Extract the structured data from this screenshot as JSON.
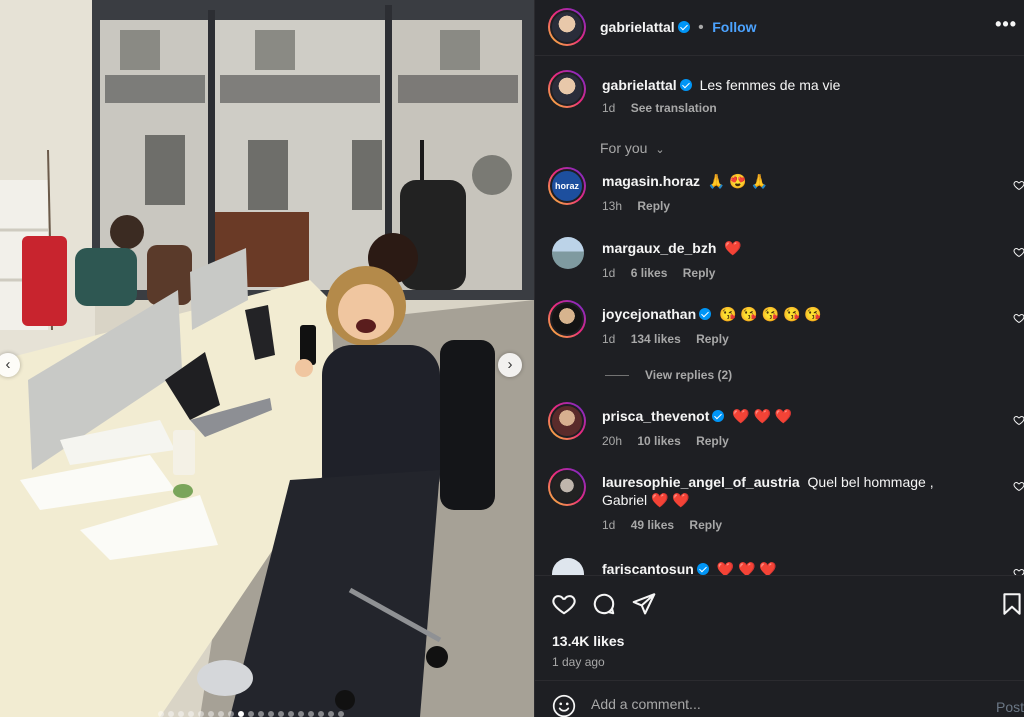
{
  "post": {
    "username": "gabrielattal",
    "follow_label": "Follow",
    "more_label": "•••",
    "caption": "Les femmes de ma vie",
    "caption_time": "1d",
    "see_translation": "See translation",
    "sort_label": "For you"
  },
  "comments": [
    {
      "user": "magasin.horaz",
      "text": "🙏 😍 🙏",
      "time": "13h",
      "likes": "",
      "reply": "Reply",
      "avatar_text": "horaz"
    },
    {
      "user": "margaux_de_bzh",
      "text": "❤️",
      "time": "1d",
      "likes": "6 likes",
      "reply": "Reply"
    },
    {
      "user": "joycejonathan",
      "text": "😘 😘 😘 😘 😘",
      "time": "1d",
      "likes": "134 likes",
      "reply": "Reply",
      "view_replies": "View replies (2)"
    },
    {
      "user": "prisca_thevenot",
      "text": "❤️ ❤️ ❤️",
      "time": "20h",
      "likes": "10 likes",
      "reply": "Reply"
    },
    {
      "user": "lauresophie_angel_of_austria",
      "text": "Quel bel hommage , Gabriel ❤️ ❤️",
      "time": "1d",
      "likes": "49 likes",
      "reply": "Reply"
    },
    {
      "user": "fariscantosun",
      "text": "❤️ ❤️ ❤️",
      "time": "",
      "likes": "",
      "reply": ""
    }
  ],
  "footer": {
    "likes": "13.4K likes",
    "date": "1 day ago",
    "comment_placeholder": "Add a comment...",
    "post_label": "Post"
  },
  "carousel": {
    "prev": "‹",
    "next": "›"
  },
  "colors": {
    "panel_bg": "#1e1f23",
    "link_blue": "#4ca3ff",
    "verified_blue": "#0095f6",
    "heart_red": "#ff3040"
  }
}
